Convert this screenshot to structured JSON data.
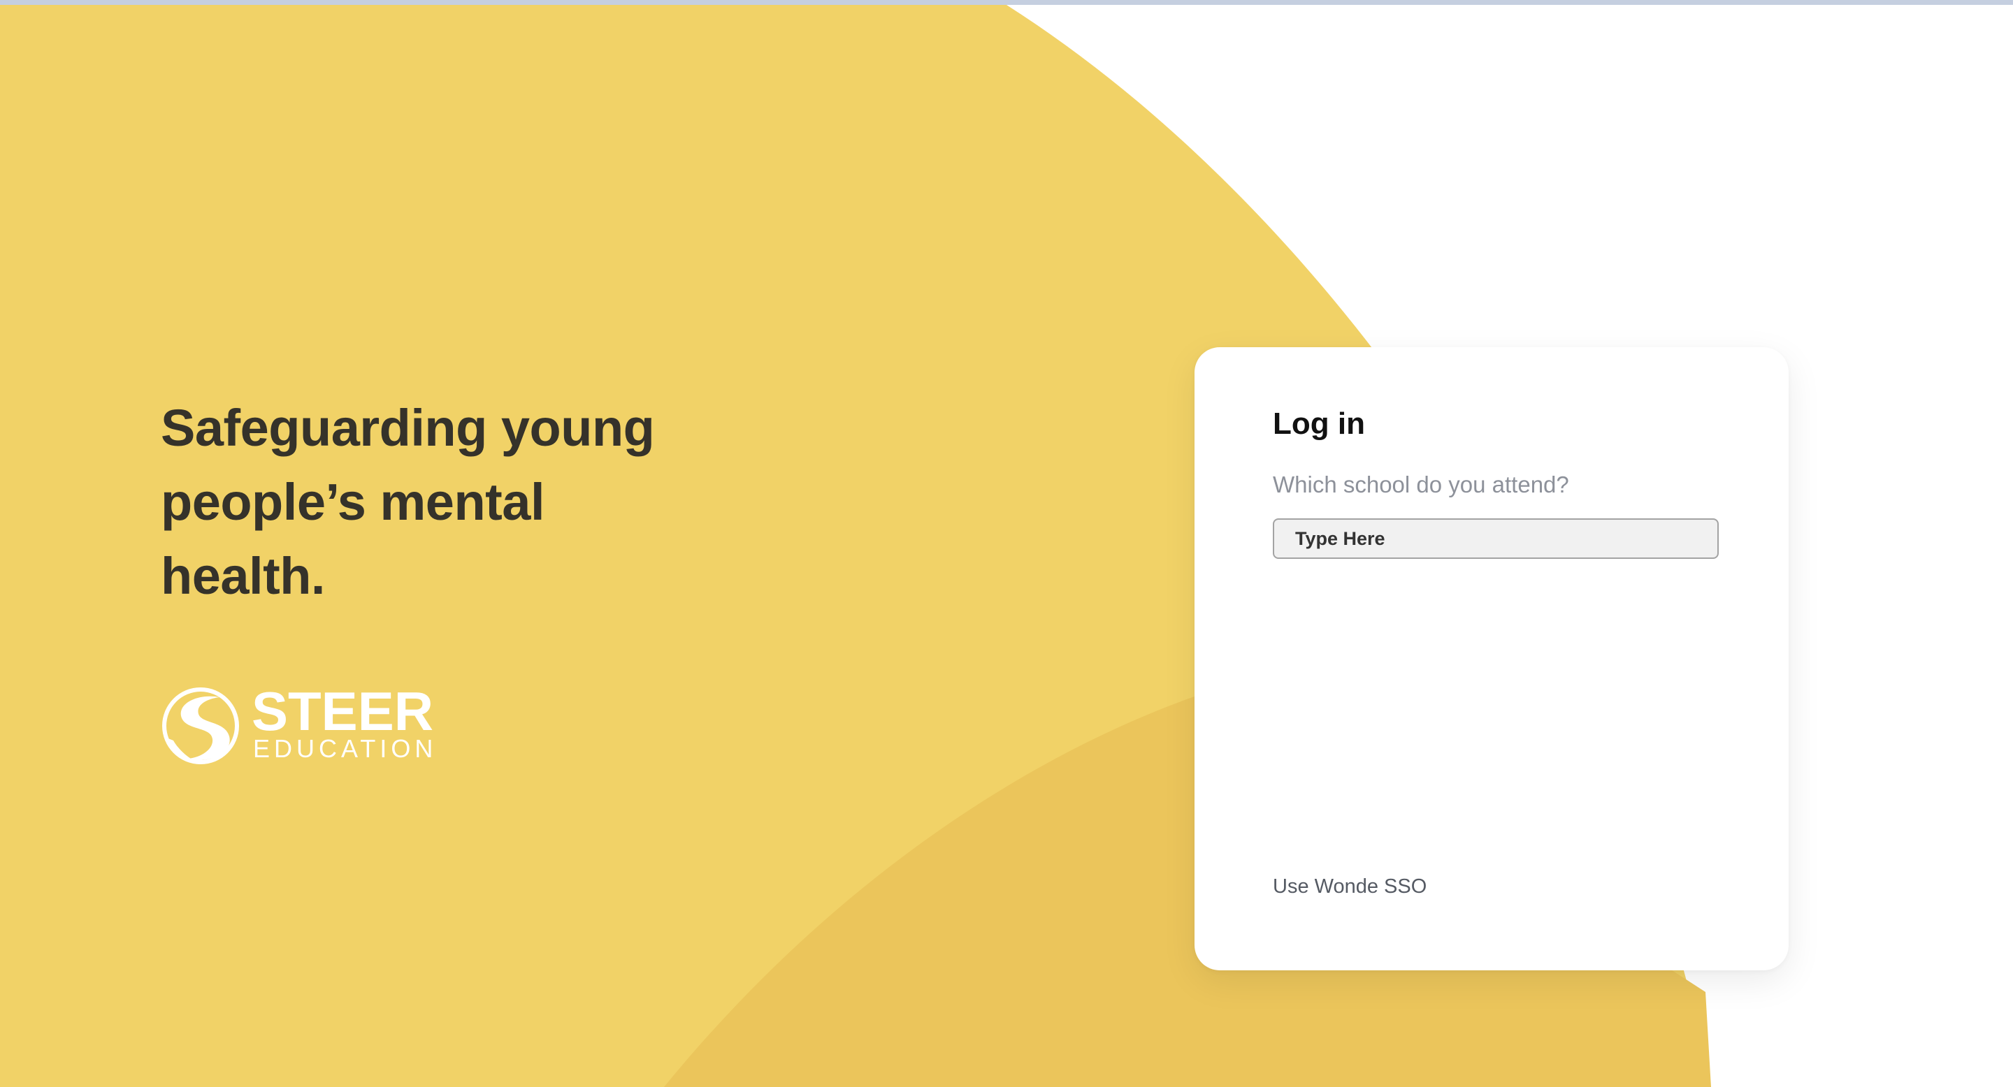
{
  "hero": {
    "tagline_line1": "Safeguarding young",
    "tagline_line2": "people’s mental",
    "tagline_line3": "health."
  },
  "brand": {
    "name": "STEER",
    "sub": "EDUCATION",
    "logo_icon": "steer-road-s-icon"
  },
  "login": {
    "title": "Log in",
    "school_label": "Which school do you attend?",
    "school_placeholder": "Type Here",
    "school_value": "",
    "sso_label": "Use Wonde SSO"
  },
  "colors": {
    "background_yellow": "#f1d267",
    "background_yellow_dark": "#ebc55b",
    "page_background": "#ffffff",
    "heading_text": "#35322a",
    "card_background": "#ffffff",
    "input_background": "#f1f1f1"
  }
}
